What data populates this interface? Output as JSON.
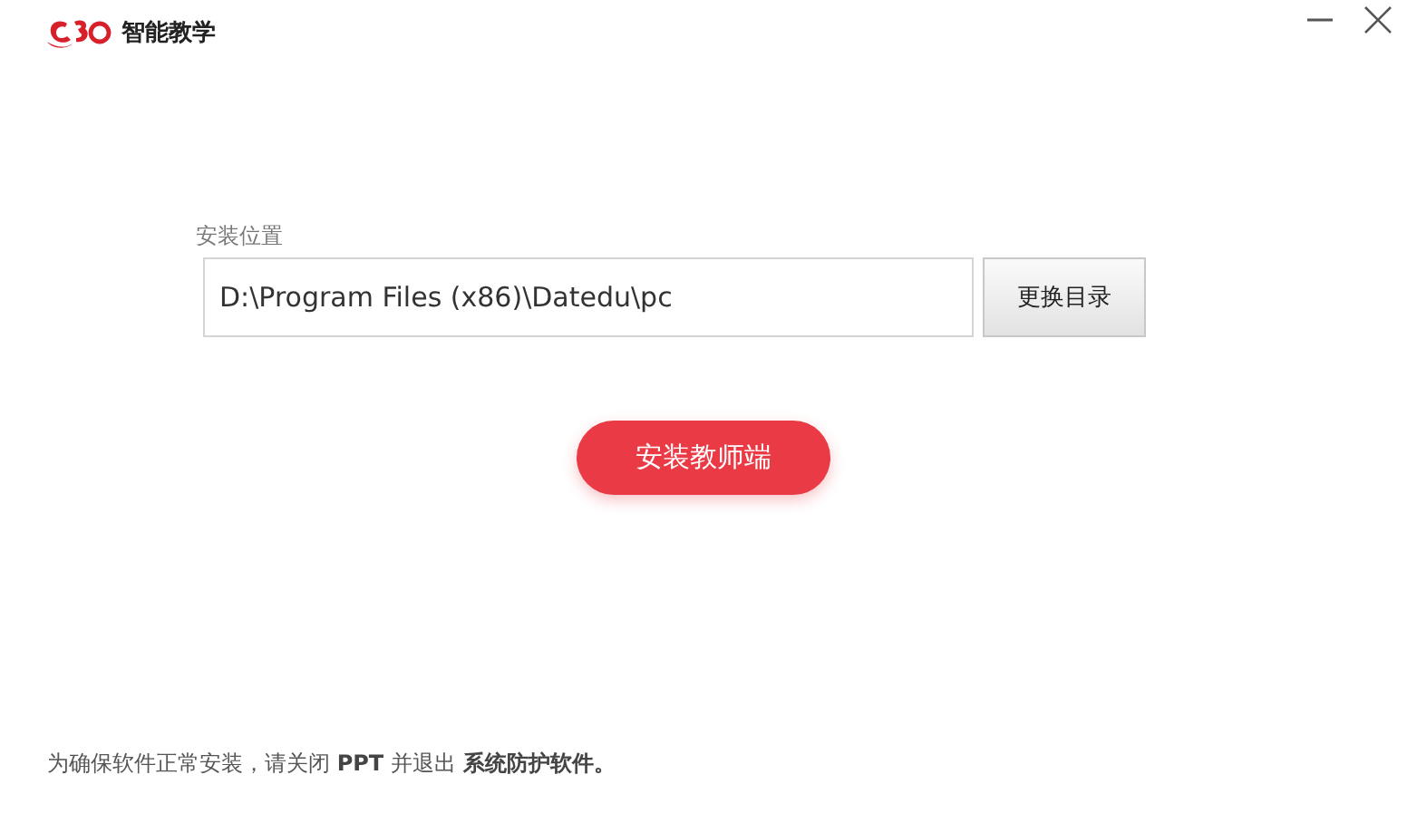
{
  "window": {
    "title": "智能教学"
  },
  "install": {
    "label": "安装位置",
    "path": "D:\\Program Files (x86)\\Datedu\\pc",
    "browse_button": "更换目录",
    "install_button": "安装教师端"
  },
  "footer": {
    "notice": "为确保软件正常安装，请关闭 **PPT** 并退出 **系统防护软件。**"
  }
}
